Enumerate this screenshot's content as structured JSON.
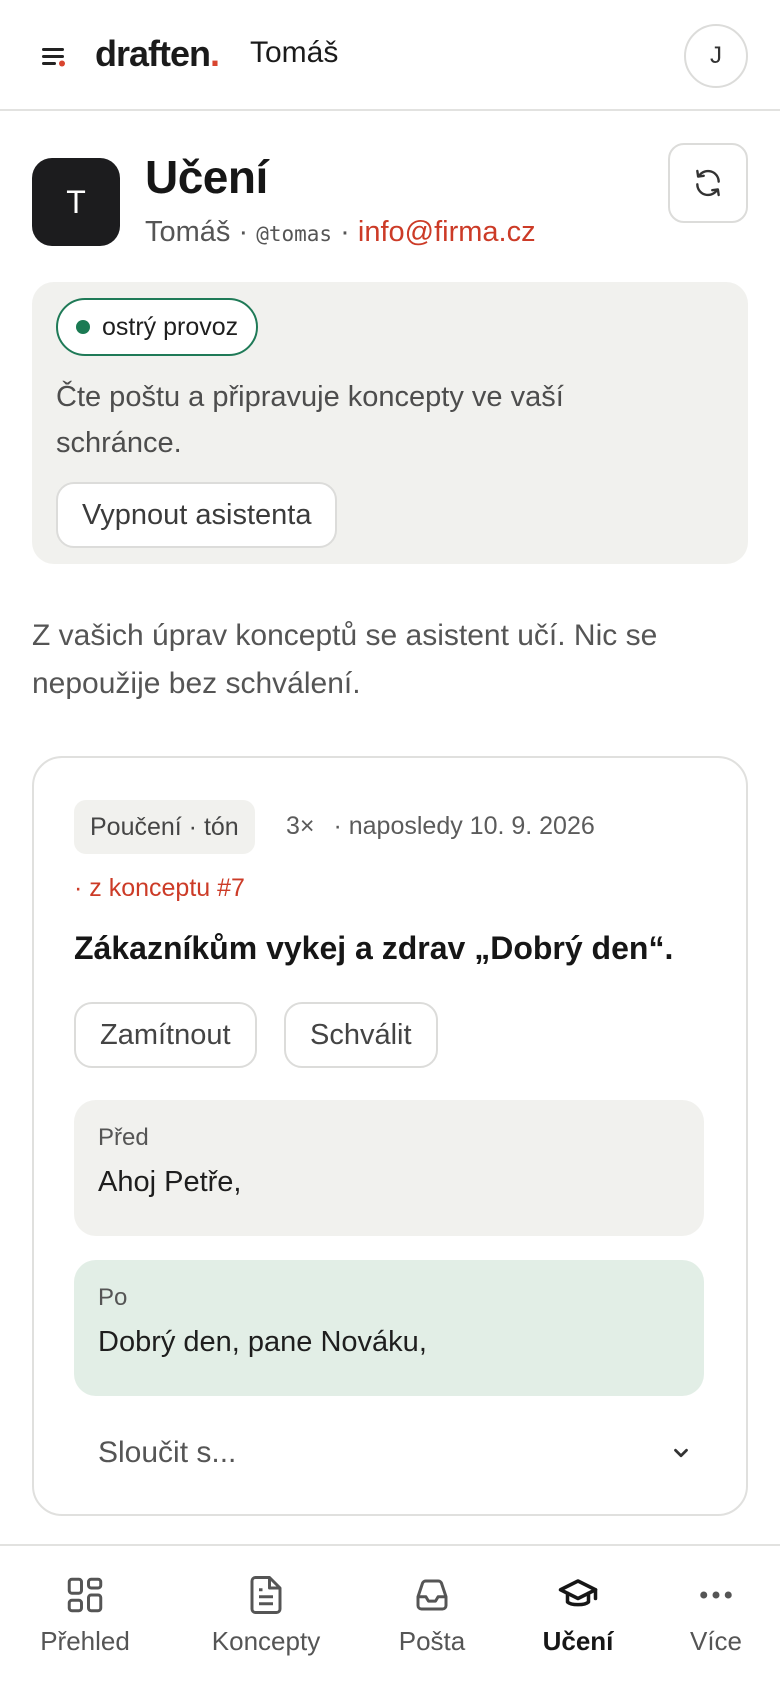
{
  "topbar": {
    "brand": "draften",
    "brand_dot": ".",
    "workspace": "Tomáš",
    "user_initial": "J"
  },
  "header": {
    "avatar_initial": "T",
    "title": "Učení",
    "name": "Tomáš",
    "sep": "·",
    "handle": "@tomas",
    "email": "info@firma.cz"
  },
  "status": {
    "badge": "ostrý provoz",
    "description": "Čte poštu a připravuje koncepty ve vaší schránce.",
    "off_button": "Vypnout asistenta"
  },
  "intro": "Z vašich úprav konceptů se asistent učí. Nic se nepoužije bez schválení.",
  "lesson": {
    "tag": "Poučení · tón",
    "count": "3×",
    "last": "· naposledy 10. 9. 2026",
    "source": "· z konceptu #7",
    "text": "Zákazníkům vykej a zdrav „Dobrý den“.",
    "reject": "Zamítnout",
    "approve": "Schválit",
    "before_label": "Před",
    "before_text": "Ahoj Petře,",
    "after_label": "Po",
    "after_text": "Dobrý den, pane Nováku,",
    "merge_placeholder": "Sloučit s..."
  },
  "nav": [
    {
      "label": "Přehled",
      "icon": "grid-icon"
    },
    {
      "label": "Koncepty",
      "icon": "document-icon"
    },
    {
      "label": "Pošta",
      "icon": "inbox-icon"
    },
    {
      "label": "Učení",
      "icon": "graduation-cap-icon",
      "active": true
    },
    {
      "label": "Více",
      "icon": "more-dots-icon"
    }
  ],
  "colors": {
    "accent": "#cc3b27",
    "live_green": "#1b7a53",
    "after_bg": "#e2eee6"
  }
}
